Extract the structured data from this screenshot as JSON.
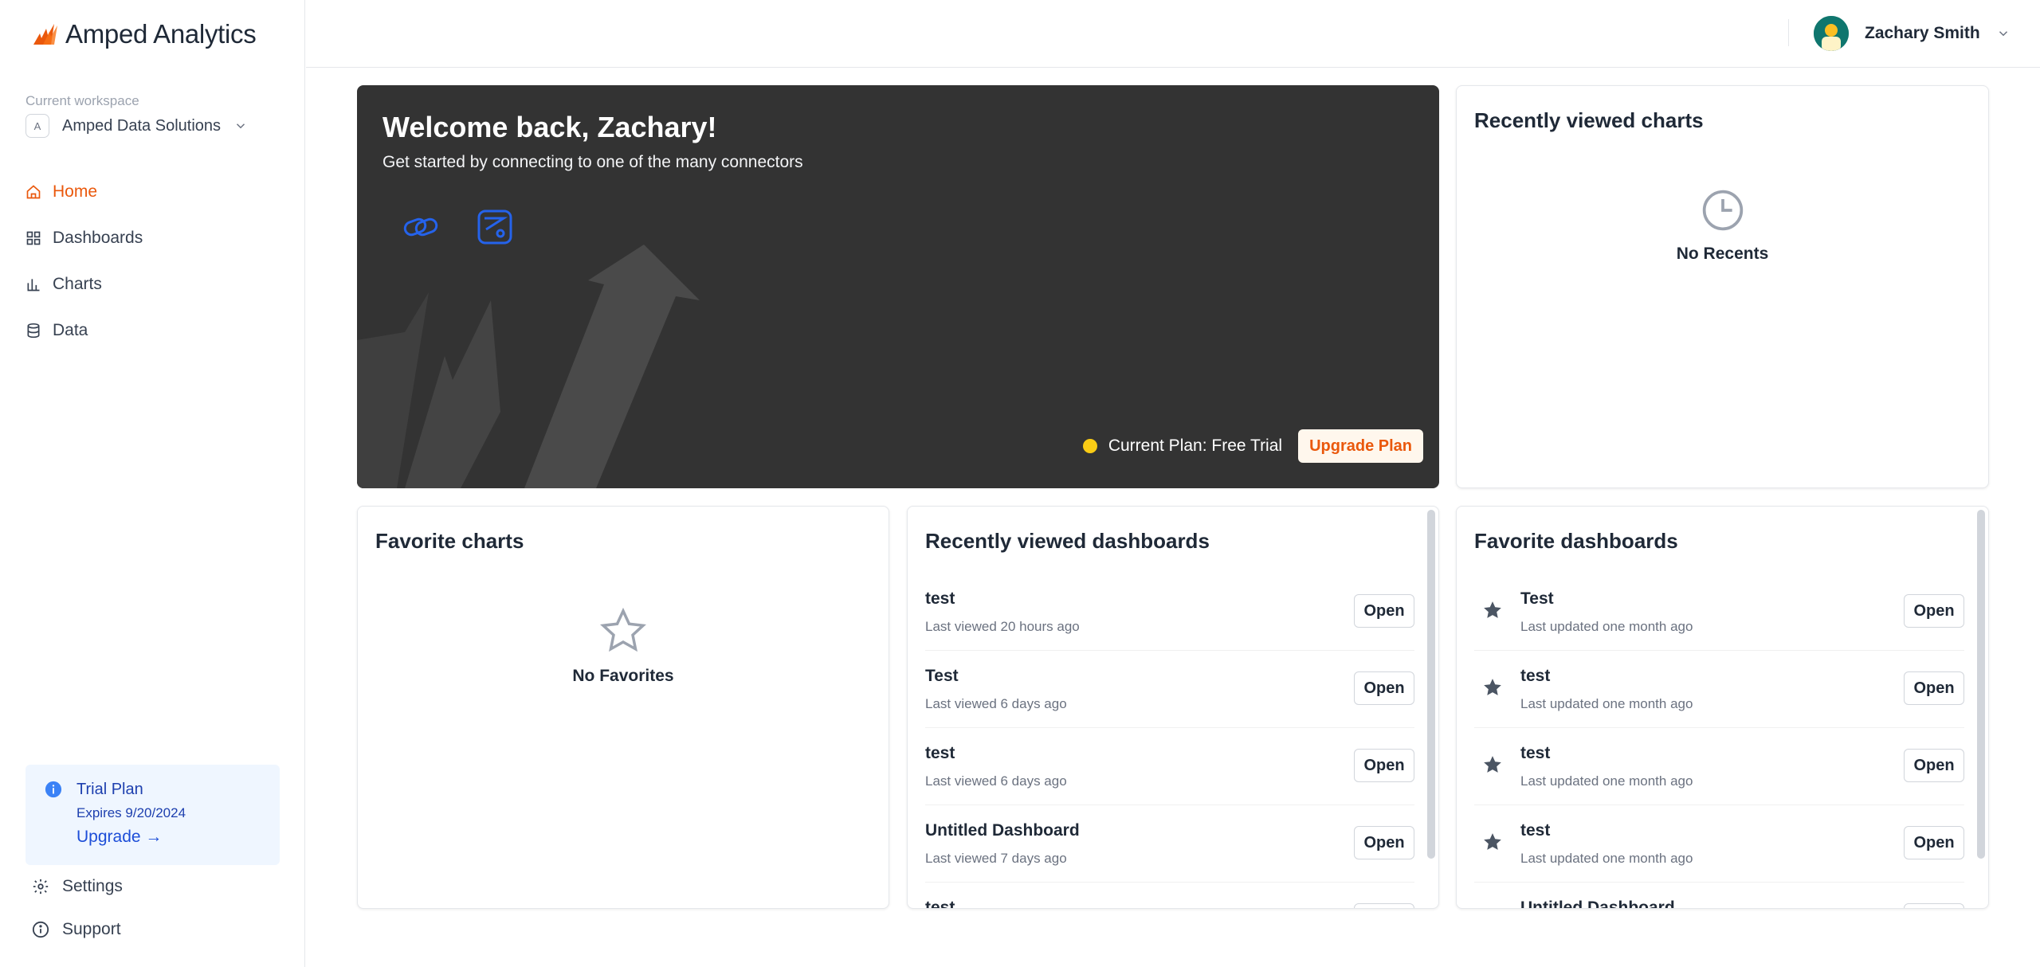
{
  "app": {
    "name": "Amped Analytics"
  },
  "workspace": {
    "label": "Current workspace",
    "initial": "A",
    "name": "Amped Data Solutions"
  },
  "nav": {
    "home": "Home",
    "dashboards": "Dashboards",
    "charts": "Charts",
    "data": "Data"
  },
  "trial": {
    "title": "Trial Plan",
    "expires": "Expires 9/20/2024",
    "upgrade": "Upgrade →"
  },
  "bottom_nav": {
    "settings": "Settings",
    "support": "Support"
  },
  "user": {
    "name": "Zachary Smith"
  },
  "welcome": {
    "title": "Welcome back, Zachary!",
    "subtitle": "Get started by connecting to one of the many connectors",
    "plan": "Current Plan: Free Trial",
    "upgrade_button": "Upgrade Plan"
  },
  "recent_charts": {
    "title": "Recently viewed charts",
    "empty": "No Recents"
  },
  "favorite_charts": {
    "title": "Favorite charts",
    "empty": "No Favorites"
  },
  "recent_dashboards": {
    "title": "Recently viewed dashboards",
    "open_label": "Open",
    "items": [
      {
        "name": "test",
        "sub": "Last viewed 20 hours ago"
      },
      {
        "name": "Test",
        "sub": "Last viewed 6 days ago"
      },
      {
        "name": "test",
        "sub": "Last viewed 6 days ago"
      },
      {
        "name": "Untitled Dashboard",
        "sub": "Last viewed 7 days ago"
      },
      {
        "name": "test",
        "sub": ""
      }
    ]
  },
  "favorite_dashboards": {
    "title": "Favorite dashboards",
    "open_label": "Open",
    "items": [
      {
        "name": "Test",
        "sub": "Last updated one month ago"
      },
      {
        "name": "test",
        "sub": "Last updated one month ago"
      },
      {
        "name": "test",
        "sub": "Last updated one month ago"
      },
      {
        "name": "test",
        "sub": "Last updated one month ago"
      },
      {
        "name": "Untitled Dashboard",
        "sub": ""
      }
    ]
  },
  "colors": {
    "accent": "#ea580c",
    "hero_bg": "#333333",
    "info": "#1e40af",
    "plan_dot": "#facc15"
  }
}
